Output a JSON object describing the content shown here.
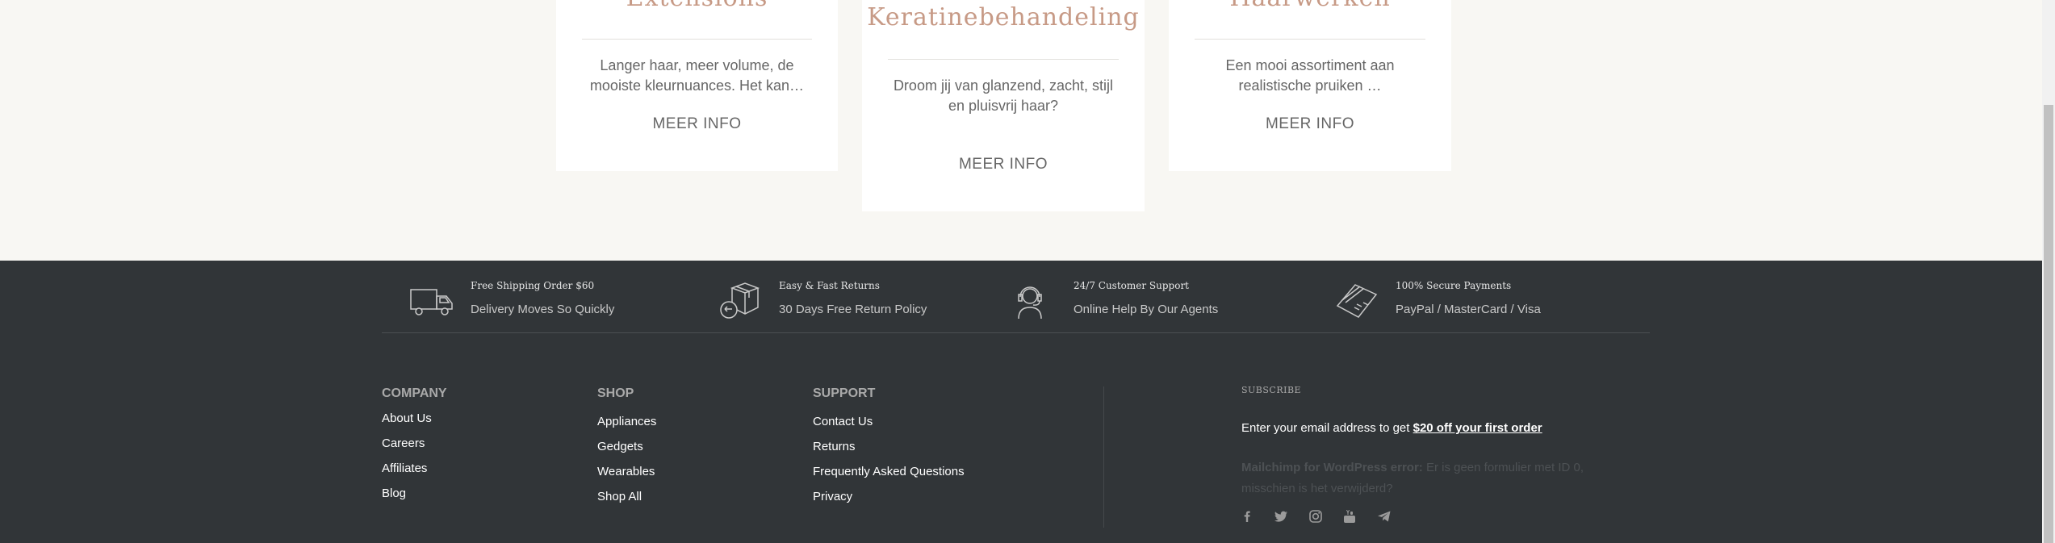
{
  "cards": [
    {
      "title": "Extensions",
      "description": "Langer haar, meer volume, de mooiste kleurnuances. Het kan…",
      "more": "MEER INFO"
    },
    {
      "title": "Keratinebehandeling",
      "description": "Droom jij van glanzend, zacht, stijl en pluisvrij haar?",
      "more": "MEER INFO"
    },
    {
      "title": "Haarwerken",
      "description": "Een mooi assortiment aan realistische pruiken …",
      "more": "MEER INFO"
    }
  ],
  "features": [
    {
      "icon": "truck-icon",
      "title": "Free Shipping Order $60",
      "text": "Delivery Moves So Quickly"
    },
    {
      "icon": "return-box-icon",
      "title": "Easy & Fast Returns",
      "text": "30 Days Free Return Policy"
    },
    {
      "icon": "headset-support-icon",
      "title": "24/7 Customer Support",
      "text": "Online Help By Our Agents"
    },
    {
      "icon": "credit-card-icon",
      "title": "100% Secure Payments",
      "text": "PayPal / MasterCard / Visa"
    }
  ],
  "columns": {
    "company": {
      "title": "COMPANY",
      "links": [
        "About Us",
        "Careers",
        "Affiliates",
        "Blog"
      ]
    },
    "shop": {
      "title": "SHOP",
      "links": [
        "Appliances",
        "Gedgets",
        "Wearables",
        "Shop All"
      ]
    },
    "support": {
      "title": "SUPPORT",
      "links": [
        "Contact Us",
        "Returns",
        "Frequently Asked Questions",
        "Privacy"
      ]
    }
  },
  "subscribe": {
    "title": "SUBSCRIBE",
    "text": "Enter your email address to get ",
    "link": "$20 off your first order",
    "error_label": "Mailchimp for WordPress error:",
    "error_text": " Er is geen formulier met ID 0, misschien is het verwijderd?"
  },
  "social_icons": [
    "facebook-icon",
    "twitter-icon",
    "instagram-icon",
    "youtube-icon",
    "telegram-icon"
  ],
  "colors": {
    "title_accent": "#c79a86",
    "footer_bg": "#313538",
    "page_bg": "#f8f7f3"
  }
}
